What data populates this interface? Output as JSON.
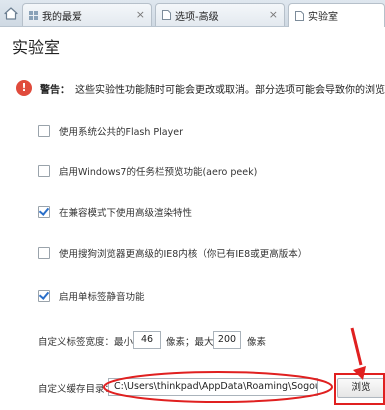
{
  "tabs": [
    {
      "label": "我的最爱"
    },
    {
      "label": "选项-高级"
    },
    {
      "label": "实验室"
    }
  ],
  "page": {
    "title": "实验室",
    "warning_label": "警告：",
    "warning_text": "这些实验性功能随时可能会更改或取消。部分选项可能会导致你的浏览器"
  },
  "options": [
    {
      "label": "使用系统公共的Flash Player",
      "checked": false
    },
    {
      "label": "启用Windows7的任务栏预览功能(aero peek)",
      "checked": false
    },
    {
      "label": "在兼容模式下使用高级渲染特性",
      "checked": true
    },
    {
      "label": "使用搜狗浏览器更高级的IE8内核（你已有IE8或更高版本）",
      "checked": false
    },
    {
      "label": "启用单标签静音功能",
      "checked": true
    }
  ],
  "tab_width": {
    "label": "自定义标签宽度：",
    "min_label": "最小",
    "min_value": "46",
    "unit_max_label": "像素；最大",
    "max_value": "200",
    "unit_label": "像素"
  },
  "cache_dir": {
    "label": "自定义缓存目录：",
    "path": "C:\\Users\\thinkpad\\AppData\\Roaming\\SogouE",
    "browse_label": "浏览"
  },
  "colors": {
    "accent": "#2a6fc9",
    "warning": "#e04b3c",
    "annotation": "#e02020"
  }
}
